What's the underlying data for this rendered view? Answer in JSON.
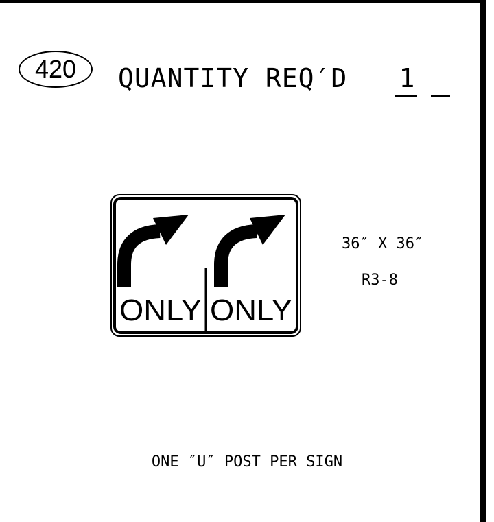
{
  "sheet": {
    "item_number": "420",
    "quantity_label": "QUANTITY REQ′D",
    "quantity_value": "1"
  },
  "sign": {
    "legend_left": "ONLY",
    "legend_right": "ONLY",
    "size": "36″ X 36″",
    "code": "R3-8",
    "arrows": [
      "right-turn-arrow",
      "right-turn-arrow"
    ],
    "colors": {
      "background": "#ffffff",
      "legend": "#000000"
    }
  },
  "note": {
    "post_text": "ONE ″U″ POST PER SIGN"
  }
}
